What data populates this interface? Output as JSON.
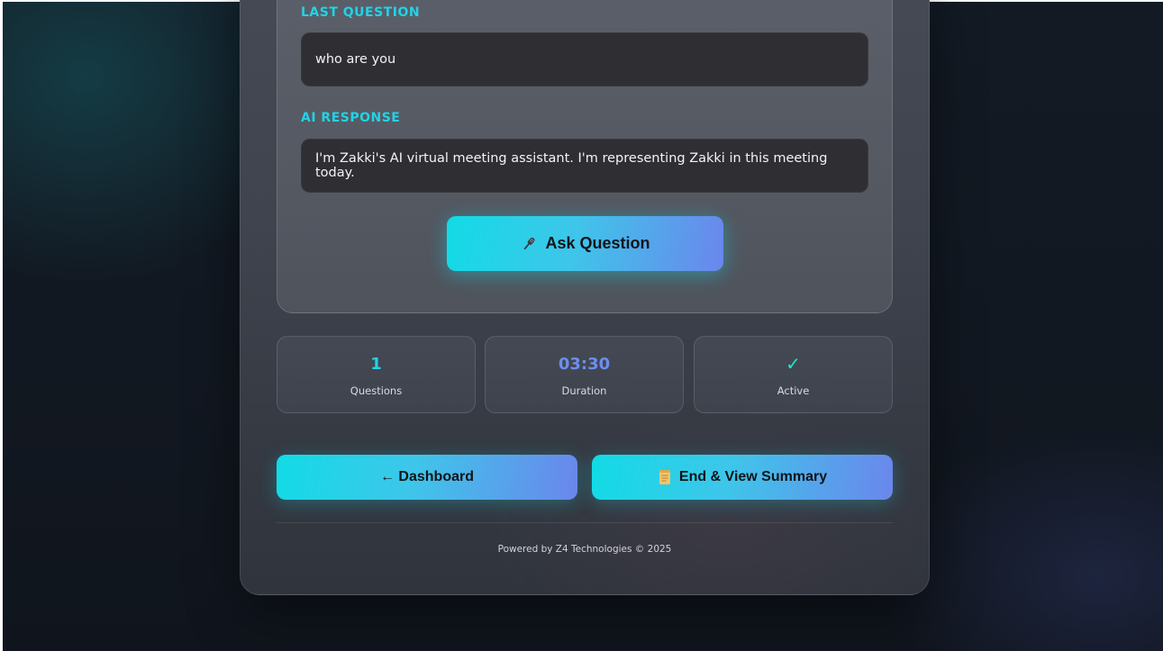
{
  "conversation": {
    "last_question_label": "LAST QUESTION",
    "last_question_text": "who are you",
    "ai_response_label": "AI RESPONSE",
    "ai_response_text": "I'm Zakki's AI virtual meeting assistant. I'm representing Zakki in this meeting today.",
    "ask_button_label": "Ask Question",
    "ask_button_icon": "microphone-icon"
  },
  "stats": [
    {
      "value": "1",
      "label": "Questions",
      "color": "#22d3e6"
    },
    {
      "value": "03:30",
      "label": "Duration",
      "color": "#6c8ef0"
    },
    {
      "value": "✓",
      "label": "Active",
      "color": "#22e6c8"
    }
  ],
  "actions": {
    "dashboard_label": "← Dashboard",
    "end_summary_label": "End & View Summary",
    "end_summary_icon": "scroll-icon"
  },
  "footer": {
    "text": "Powered by Z4 Technologies © 2025"
  },
  "colors": {
    "accent": "#22d3e6",
    "gradient_start": "#12dbe6",
    "gradient_end": "#6b86ec",
    "background": "#121821"
  }
}
